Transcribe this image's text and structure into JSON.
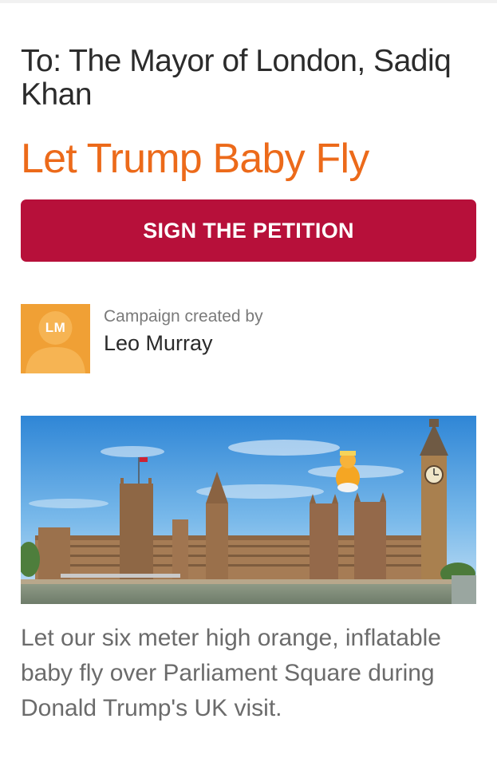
{
  "petition": {
    "to_line": "To: The Mayor of London, Sadiq Khan",
    "title": "Let Trump Baby Fly",
    "sign_button_label": "SIGN THE PETITION",
    "creator_caption": "Campaign created by",
    "creator_name": "Leo Murray",
    "avatar_initials": "LM",
    "description": "Let our six meter high orange, inflatable baby fly over Parliament Square during Donald Trump's UK visit."
  },
  "colors": {
    "title": "#ec6a1a",
    "sign_button": "#b7103a",
    "avatar_bg": "#f0a035"
  },
  "icons": {
    "avatar": "avatar-placeholder-icon"
  }
}
